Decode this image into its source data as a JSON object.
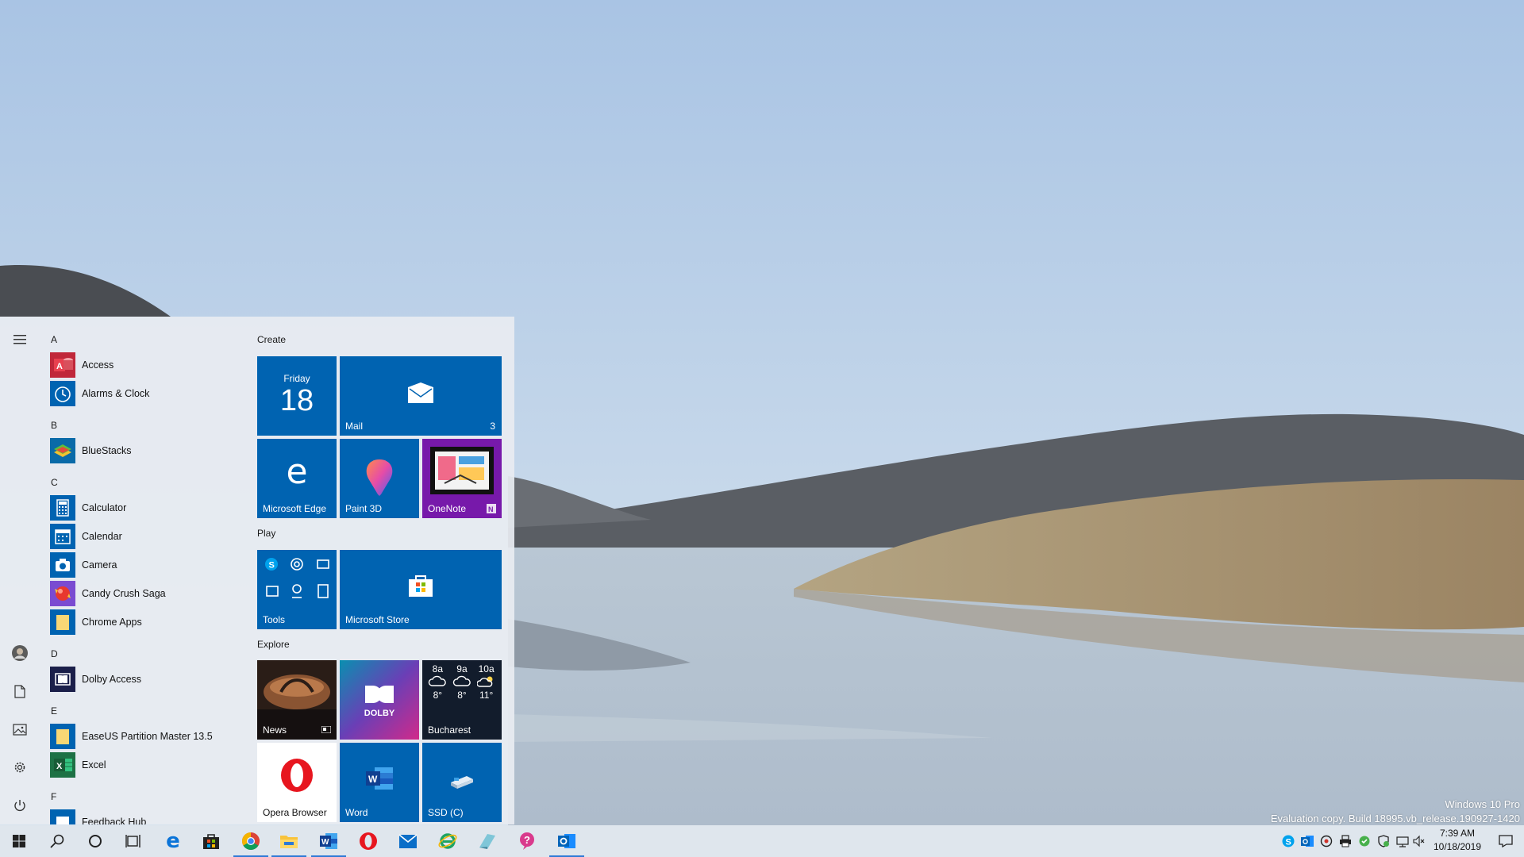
{
  "watermark": {
    "edition": "Windows 10 Pro",
    "build": "Evaluation copy. Build 18995.vb_release.190927-1420"
  },
  "start_menu": {
    "app_list": {
      "items": [
        {
          "type": "letter",
          "label": "A"
        },
        {
          "type": "app",
          "label": "Access",
          "icon": "access-icon"
        },
        {
          "type": "app",
          "label": "Alarms & Clock",
          "icon": "alarms-clock-icon"
        },
        {
          "type": "letter",
          "label": "B"
        },
        {
          "type": "app",
          "label": "BlueStacks",
          "icon": "bluestacks-icon"
        },
        {
          "type": "letter",
          "label": "C"
        },
        {
          "type": "app",
          "label": "Calculator",
          "icon": "calculator-icon"
        },
        {
          "type": "app",
          "label": "Calendar",
          "icon": "calendar-icon"
        },
        {
          "type": "app",
          "label": "Camera",
          "icon": "camera-icon"
        },
        {
          "type": "app",
          "label": "Candy Crush Saga",
          "icon": "candy-crush-icon"
        },
        {
          "type": "app",
          "label": "Chrome Apps",
          "icon": "folder-icon",
          "expandable": true
        },
        {
          "type": "letter",
          "label": "D"
        },
        {
          "type": "app",
          "label": "Dolby Access",
          "icon": "dolby-icon"
        },
        {
          "type": "letter",
          "label": "E"
        },
        {
          "type": "app",
          "label": "EaseUS Partition Master 13.5",
          "icon": "folder-icon",
          "expandable": true
        },
        {
          "type": "app",
          "label": "Excel",
          "icon": "excel-icon"
        },
        {
          "type": "letter",
          "label": "F"
        },
        {
          "type": "app",
          "label": "Feedback Hub",
          "icon": "feedback-hub-icon"
        }
      ]
    },
    "groups": {
      "create": "Create",
      "play": "Play",
      "explore": "Explore"
    },
    "tiles": {
      "calendar": {
        "day": "Friday",
        "date": "18"
      },
      "mail": {
        "label": "Mail",
        "badge": "3"
      },
      "edge": {
        "label": "Microsoft Edge"
      },
      "paint3d": {
        "label": "Paint 3D"
      },
      "onenote": {
        "label": "OneNote"
      },
      "tools": {
        "label": "Tools"
      },
      "store": {
        "label": "Microsoft Store"
      },
      "news": {
        "label": "News"
      },
      "dolby": {
        "label": "DOLBY"
      },
      "weather": {
        "location": "Bucharest",
        "hours": [
          {
            "time": "8a",
            "temp": "8°",
            "icon": "cloud-icon"
          },
          {
            "time": "9a",
            "temp": "8°",
            "icon": "cloud-icon"
          },
          {
            "time": "10a",
            "temp": "11°",
            "icon": "partly-sunny-icon"
          }
        ]
      },
      "opera": {
        "label": "Opera Browser"
      },
      "word": {
        "label": "Word"
      },
      "ssd": {
        "label": "SSD (C)"
      }
    }
  },
  "taskbar": {
    "clock": {
      "time": "7:39 AM",
      "date": "10/18/2019"
    },
    "pinned": [
      "edge-icon",
      "store-icon",
      "chrome-icon",
      "file-explorer-icon",
      "word-icon",
      "opera-icon",
      "mail-icon",
      "internet-explorer-icon",
      "notepad-icon",
      "feedback-hub-icon",
      "outlook-icon"
    ],
    "tray": [
      "skype-icon",
      "outlook-icon",
      "network-icon",
      "printer-icon",
      "security-icon",
      "defender-icon",
      "wifi-icon",
      "volume-muted-icon"
    ]
  },
  "colors": {
    "accent": "#0063b1",
    "onenote": "#7719aa",
    "taskbar": "#dfe6ed"
  }
}
